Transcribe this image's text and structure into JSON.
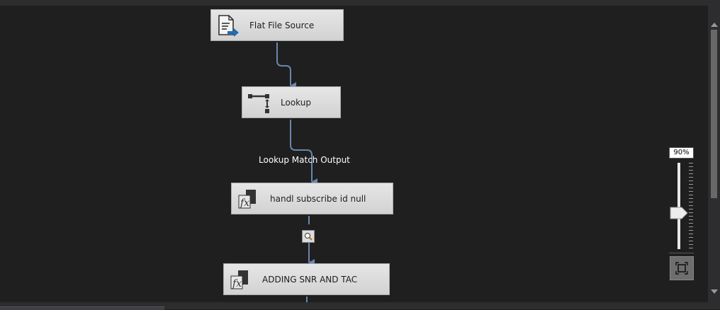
{
  "nodes": {
    "flat_file_source": {
      "label": "Flat File Source",
      "icon": "flat-file-source-icon"
    },
    "lookup": {
      "label": "Lookup",
      "icon": "lookup-icon"
    },
    "handl_subscribe": {
      "label": "handl subscribe id null",
      "icon": "derived-column-fx-icon"
    },
    "adding_snr_tac": {
      "label": "ADDING SNR AND TAC",
      "icon": "derived-column-fx-icon"
    }
  },
  "edges": {
    "lookup_output_label": "Lookup Match Output"
  },
  "zoom": {
    "level_label": "90%",
    "level_percent": 90
  },
  "colors": {
    "canvas_bg": "#1f1f1f",
    "connector": "#6b86ad",
    "node_bg": "#dcdcdc",
    "arrow_blue": "#1c6fb8"
  }
}
